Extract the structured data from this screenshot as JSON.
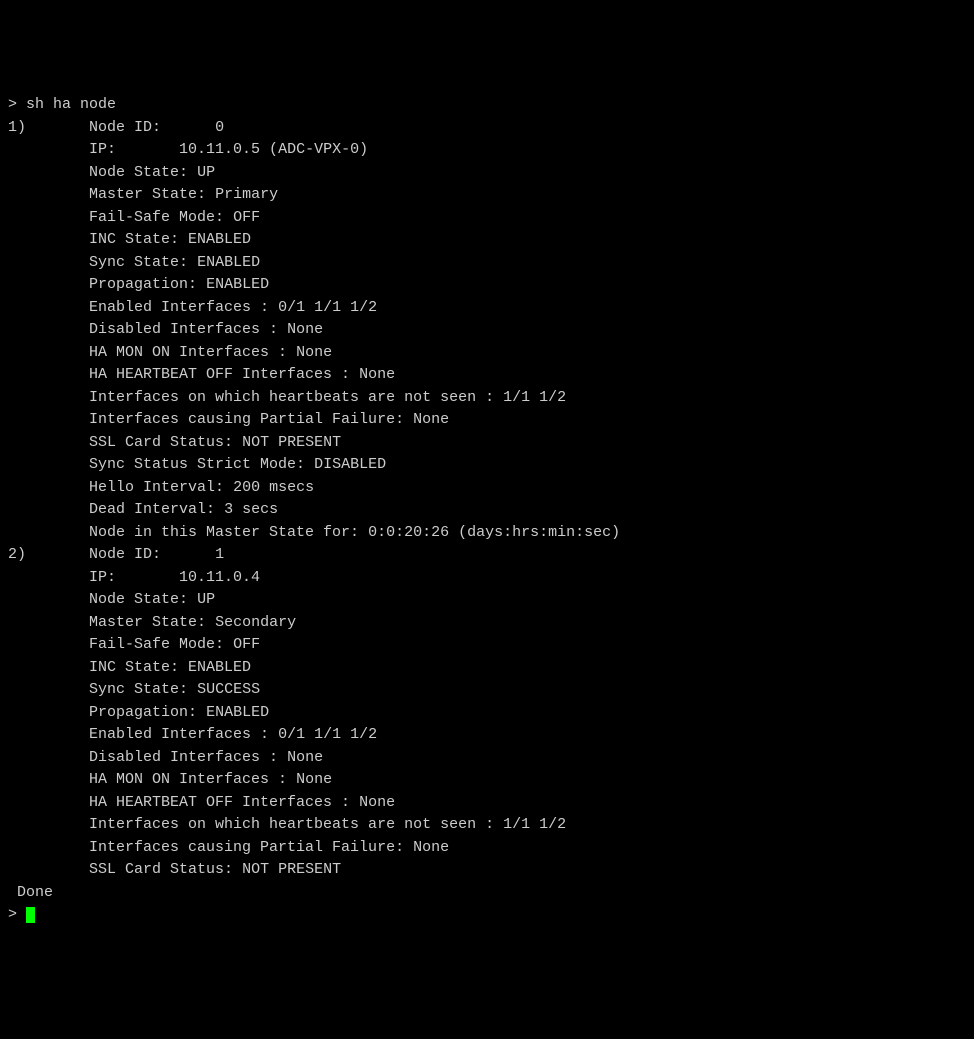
{
  "prompt": ">",
  "command": "sh ha node",
  "nodes": [
    {
      "index": "1)",
      "lines": [
        {
          "label": "Node ID:",
          "value": "0",
          "padA": "       ",
          "padB": "      "
        },
        {
          "label": "IP:",
          "value": "10.11.0.5 (ADC-VPX-0)",
          "padA": "       ",
          "padB": "       "
        },
        {
          "label": "Node State:",
          "value": "UP",
          "padA": "       ",
          "padB": " "
        },
        {
          "label": "Master State:",
          "value": "Primary",
          "padA": "       ",
          "padB": " "
        },
        {
          "label": "Fail-Safe Mode:",
          "value": "OFF",
          "padA": "       ",
          "padB": " "
        },
        {
          "label": "INC State:",
          "value": "ENABLED",
          "padA": "       ",
          "padB": " "
        },
        {
          "label": "Sync State:",
          "value": "ENABLED",
          "padA": "       ",
          "padB": " "
        },
        {
          "label": "Propagation:",
          "value": "ENABLED",
          "padA": "       ",
          "padB": " "
        },
        {
          "label": "Enabled Interfaces :",
          "value": "0/1 1/1 1/2",
          "padA": "       ",
          "padB": " "
        },
        {
          "label": "Disabled Interfaces :",
          "value": "None",
          "padA": "       ",
          "padB": " "
        },
        {
          "label": "HA MON ON Interfaces :",
          "value": "None",
          "padA": "       ",
          "padB": " "
        },
        {
          "label": "HA HEARTBEAT OFF Interfaces :",
          "value": "None",
          "padA": "       ",
          "padB": " "
        },
        {
          "label": "Interfaces on which heartbeats are not seen :",
          "value": "1/1 1/2",
          "padA": "       ",
          "padB": " "
        },
        {
          "label": "Interfaces causing Partial Failure:",
          "value": "None",
          "padA": "       ",
          "padB": " "
        },
        {
          "label": "SSL Card Status:",
          "value": "NOT PRESENT",
          "padA": "       ",
          "padB": " "
        },
        {
          "label": "Sync Status Strict Mode:",
          "value": "DISABLED",
          "padA": "       ",
          "padB": " "
        },
        {
          "label": "Hello Interval:",
          "value": "200 msecs",
          "padA": "       ",
          "padB": " "
        },
        {
          "label": "Dead Interval:",
          "value": "3 secs",
          "padA": "       ",
          "padB": " "
        },
        {
          "label": "Node in this Master State for:",
          "value": "0:0:20:26 (days:hrs:min:sec)",
          "padA": "       ",
          "padB": " "
        }
      ]
    },
    {
      "index": "2)",
      "lines": [
        {
          "label": "Node ID:",
          "value": "1",
          "padA": "       ",
          "padB": "      "
        },
        {
          "label": "IP:",
          "value": "10.11.0.4",
          "padA": "       ",
          "padB": "       "
        },
        {
          "label": "Node State:",
          "value": "UP",
          "padA": "       ",
          "padB": " "
        },
        {
          "label": "Master State:",
          "value": "Secondary",
          "padA": "       ",
          "padB": " "
        },
        {
          "label": "Fail-Safe Mode:",
          "value": "OFF",
          "padA": "       ",
          "padB": " "
        },
        {
          "label": "INC State:",
          "value": "ENABLED",
          "padA": "       ",
          "padB": " "
        },
        {
          "label": "Sync State:",
          "value": "SUCCESS",
          "padA": "       ",
          "padB": " "
        },
        {
          "label": "Propagation:",
          "value": "ENABLED",
          "padA": "       ",
          "padB": " "
        },
        {
          "label": "Enabled Interfaces :",
          "value": "0/1 1/1 1/2",
          "padA": "       ",
          "padB": " "
        },
        {
          "label": "Disabled Interfaces :",
          "value": "None",
          "padA": "       ",
          "padB": " "
        },
        {
          "label": "HA MON ON Interfaces :",
          "value": "None",
          "padA": "       ",
          "padB": " "
        },
        {
          "label": "HA HEARTBEAT OFF Interfaces :",
          "value": "None",
          "padA": "       ",
          "padB": " "
        },
        {
          "label": "Interfaces on which heartbeats are not seen :",
          "value": "1/1 1/2",
          "padA": "       ",
          "padB": " "
        },
        {
          "label": "Interfaces causing Partial Failure:",
          "value": "None",
          "padA": "       ",
          "padB": " "
        },
        {
          "label": "SSL Card Status:",
          "value": "NOT PRESENT",
          "padA": "       ",
          "padB": " "
        }
      ]
    }
  ],
  "done": " Done",
  "trailing_prompt": "> "
}
